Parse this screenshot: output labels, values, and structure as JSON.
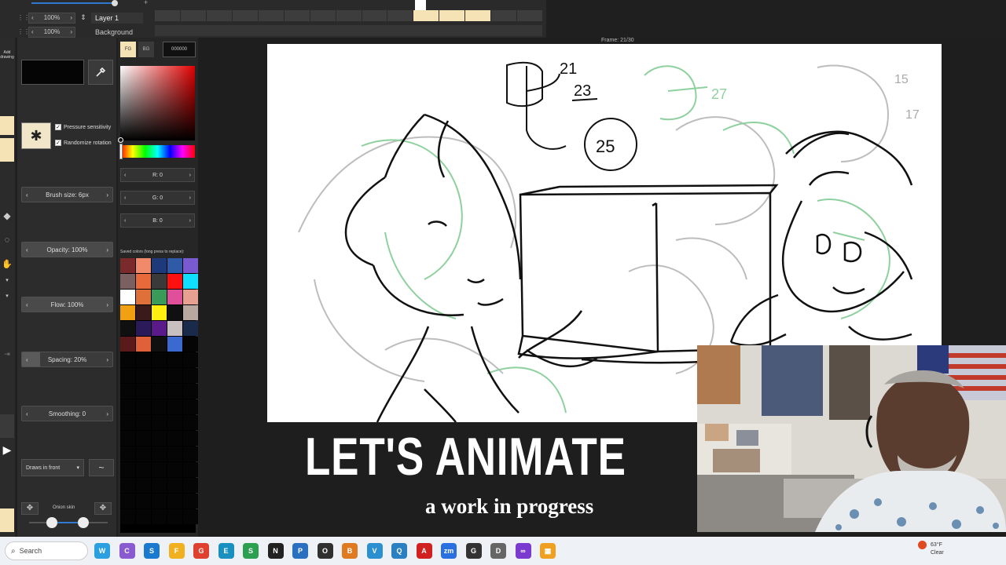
{
  "layers": {
    "rows": [
      {
        "zoom": "100%",
        "name": "Layer 1"
      },
      {
        "zoom": "100%",
        "name": "Background"
      }
    ]
  },
  "toolbar": {
    "add_drawing": "Add drawing"
  },
  "brush": {
    "pressure_label": "Pressure sensitivity",
    "randomize_label": "Randomize rotation",
    "size": "Brush size: 6px",
    "opacity": "Opacity: 100%",
    "flow": "Flow: 100%",
    "spacing": "Spacing: 20%",
    "smoothing": "Smoothing: 0",
    "draw_mode": "Draws in front",
    "onion_label": "Onion skin"
  },
  "color": {
    "fg_label": "FG",
    "bg_label": "BG",
    "hex": "000000",
    "r": "R: 0",
    "g": "G: 0",
    "b": "B: 0",
    "saved_label": "Saved colors (long press to replace):",
    "swatches": [
      "#7a2a2a",
      "#f08a6a",
      "#1f3a7a",
      "#2f5aa5",
      "#7a5ad0",
      "#7a6060",
      "#e86a3a",
      "#3a3a3a",
      "#ff1010",
      "#10e0ff",
      "#ffffff",
      "#e0703a",
      "#3a9a5a",
      "#e0509a",
      "#e8a090",
      "#f0a010",
      "#3a1a1a",
      "#ffee10",
      "#101010",
      "#b8a8a0",
      "#101010",
      "#2a1a5a",
      "#5a1a8a",
      "#c8c0c0",
      "#1a2a4a",
      "#5a1a1a",
      "#e0603a",
      "#101010",
      "#3a6ad0",
      "#050505"
    ]
  },
  "canvas": {
    "frame": "Frame: 21/30",
    "frame_numbers": [
      "21",
      "23",
      "25",
      "27",
      "15",
      "17"
    ]
  },
  "overlay": {
    "title": "LET'S ANIMATE",
    "subtitle": "a work in progress"
  },
  "taskbar": {
    "search_placeholder": "Search",
    "temperature": "63°F",
    "weather": "Clear",
    "apps": [
      {
        "name": "widgets",
        "color": "#2aa0e0",
        "glyph": "W"
      },
      {
        "name": "copilot",
        "color": "#8a5ad0",
        "glyph": "C"
      },
      {
        "name": "store",
        "color": "#1a7ad0",
        "glyph": "S"
      },
      {
        "name": "file-explorer",
        "color": "#f0b020",
        "glyph": "F"
      },
      {
        "name": "chrome",
        "color": "#e04030",
        "glyph": "G"
      },
      {
        "name": "edge",
        "color": "#1a90c0",
        "glyph": "E"
      },
      {
        "name": "sheets",
        "color": "#2aa050",
        "glyph": "S"
      },
      {
        "name": "notes",
        "color": "#222222",
        "glyph": "N"
      },
      {
        "name": "paint",
        "color": "#2a70c0",
        "glyph": "P"
      },
      {
        "name": "obs",
        "color": "#303030",
        "glyph": "O"
      },
      {
        "name": "blender",
        "color": "#e07a20",
        "glyph": "B"
      },
      {
        "name": "vpn",
        "color": "#2a90d0",
        "glyph": "V"
      },
      {
        "name": "quicktime",
        "color": "#2a80c0",
        "glyph": "Q"
      },
      {
        "name": "acrobat",
        "color": "#d02020",
        "glyph": "A"
      },
      {
        "name": "zoom",
        "color": "#2a70e0",
        "glyph": "zm"
      },
      {
        "name": "chatgpt",
        "color": "#333333",
        "glyph": "G"
      },
      {
        "name": "sketch-app",
        "color": "#666666",
        "glyph": "D"
      },
      {
        "name": "infinity",
        "color": "#7a3ad0",
        "glyph": "∞"
      },
      {
        "name": "windows-apps",
        "color": "#f0a020",
        "glyph": "▦"
      }
    ]
  }
}
